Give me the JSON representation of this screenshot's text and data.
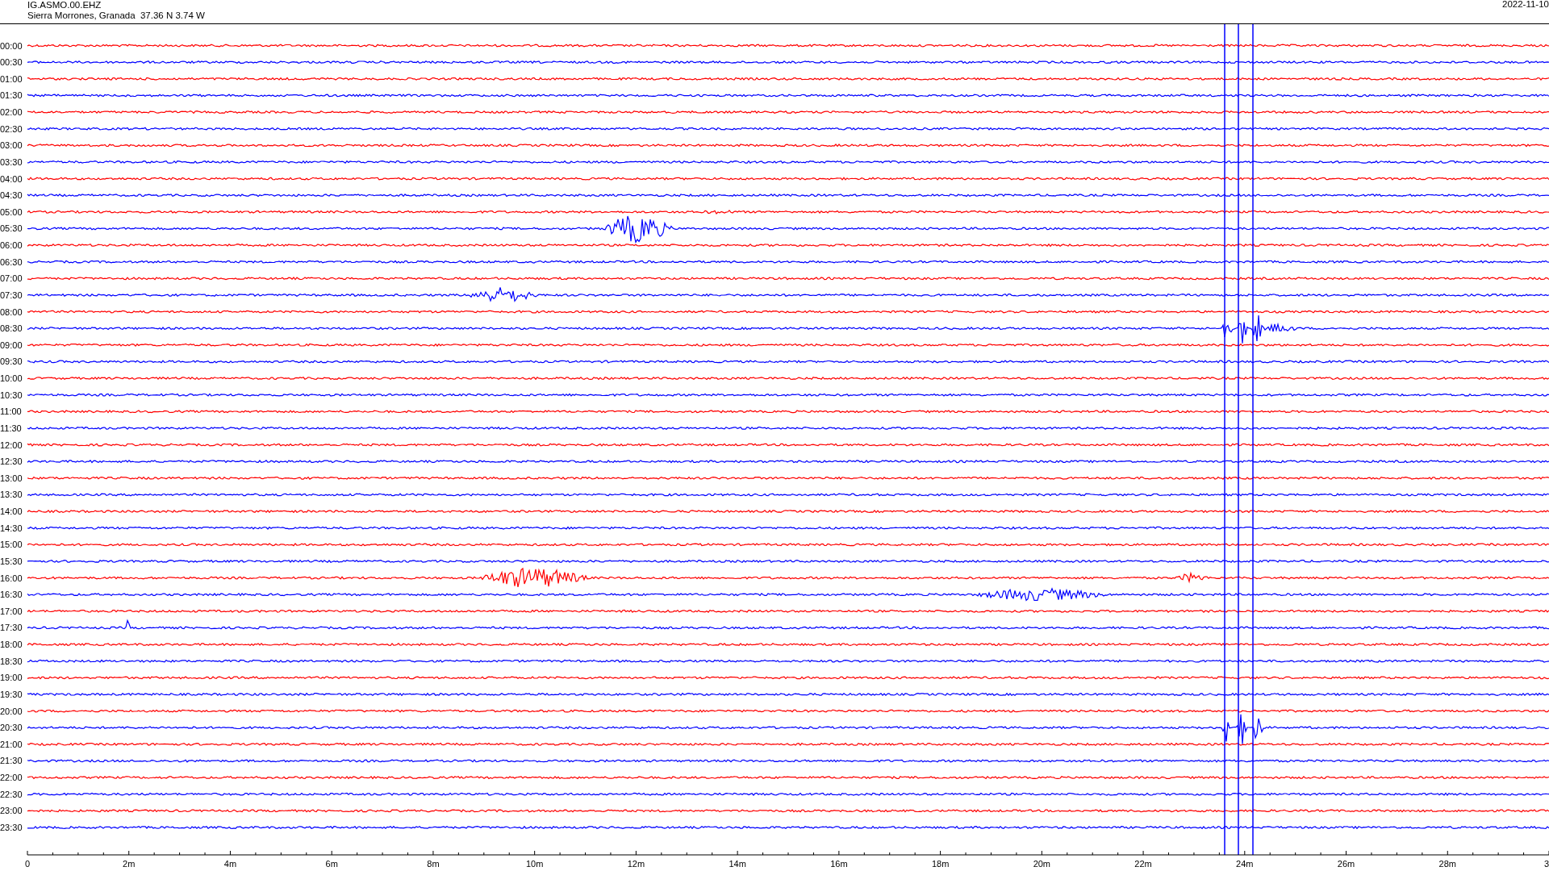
{
  "station": {
    "code": "IG.ASMO.00.EHZ",
    "location": "Sierra Morrones, Granada  37.36 N 3.74 W",
    "date": "2022-11-10"
  },
  "rows": [
    {
      "label": "00:00",
      "color": "#ff0000"
    },
    {
      "label": "00:30",
      "color": "#0000ff"
    },
    {
      "label": "01:00",
      "color": "#ff0000"
    },
    {
      "label": "01:30",
      "color": "#0000ff"
    },
    {
      "label": "02:00",
      "color": "#ff0000"
    },
    {
      "label": "02:30",
      "color": "#0000ff"
    },
    {
      "label": "03:00",
      "color": "#ff0000"
    },
    {
      "label": "03:30",
      "color": "#0000ff"
    },
    {
      "label": "04:00",
      "color": "#ff0000"
    },
    {
      "label": "04:30",
      "color": "#0000ff"
    },
    {
      "label": "05:00",
      "color": "#ff0000"
    },
    {
      "label": "05:30",
      "color": "#0000ff"
    },
    {
      "label": "06:00",
      "color": "#ff0000"
    },
    {
      "label": "06:30",
      "color": "#0000ff"
    },
    {
      "label": "07:00",
      "color": "#ff0000"
    },
    {
      "label": "07:30",
      "color": "#0000ff"
    },
    {
      "label": "08:00",
      "color": "#ff0000"
    },
    {
      "label": "08:30",
      "color": "#0000ff"
    },
    {
      "label": "09:00",
      "color": "#ff0000"
    },
    {
      "label": "09:30",
      "color": "#0000ff"
    },
    {
      "label": "10:00",
      "color": "#ff0000"
    },
    {
      "label": "10:30",
      "color": "#0000ff"
    },
    {
      "label": "11:00",
      "color": "#ff0000"
    },
    {
      "label": "11:30",
      "color": "#0000ff"
    },
    {
      "label": "12:00",
      "color": "#ff0000"
    },
    {
      "label": "12:30",
      "color": "#0000ff"
    },
    {
      "label": "13:00",
      "color": "#ff0000"
    },
    {
      "label": "13:30",
      "color": "#0000ff"
    },
    {
      "label": "14:00",
      "color": "#ff0000"
    },
    {
      "label": "14:30",
      "color": "#0000ff"
    },
    {
      "label": "15:00",
      "color": "#ff0000"
    },
    {
      "label": "15:30",
      "color": "#0000ff"
    },
    {
      "label": "16:00",
      "color": "#ff0000"
    },
    {
      "label": "16:30",
      "color": "#0000ff"
    },
    {
      "label": "17:00",
      "color": "#ff0000"
    },
    {
      "label": "17:30",
      "color": "#0000ff"
    },
    {
      "label": "18:00",
      "color": "#ff0000"
    },
    {
      "label": "18:30",
      "color": "#0000ff"
    },
    {
      "label": "19:00",
      "color": "#ff0000"
    },
    {
      "label": "19:30",
      "color": "#0000ff"
    },
    {
      "label": "20:00",
      "color": "#ff0000"
    },
    {
      "label": "20:30",
      "color": "#0000ff"
    },
    {
      "label": "21:00",
      "color": "#ff0000"
    },
    {
      "label": "21:30",
      "color": "#0000ff"
    },
    {
      "label": "22:00",
      "color": "#ff0000"
    },
    {
      "label": "22:30",
      "color": "#0000ff"
    },
    {
      "label": "23:00",
      "color": "#ff0000"
    },
    {
      "label": "23:30",
      "color": "#0000ff"
    }
  ],
  "x_axis": {
    "ticks": [
      "0",
      "2m",
      "4m",
      "6m",
      "8m",
      "10m",
      "12m",
      "14m",
      "16m",
      "18m",
      "20m",
      "22m",
      "24m",
      "26m",
      "28m",
      "3"
    ]
  }
}
